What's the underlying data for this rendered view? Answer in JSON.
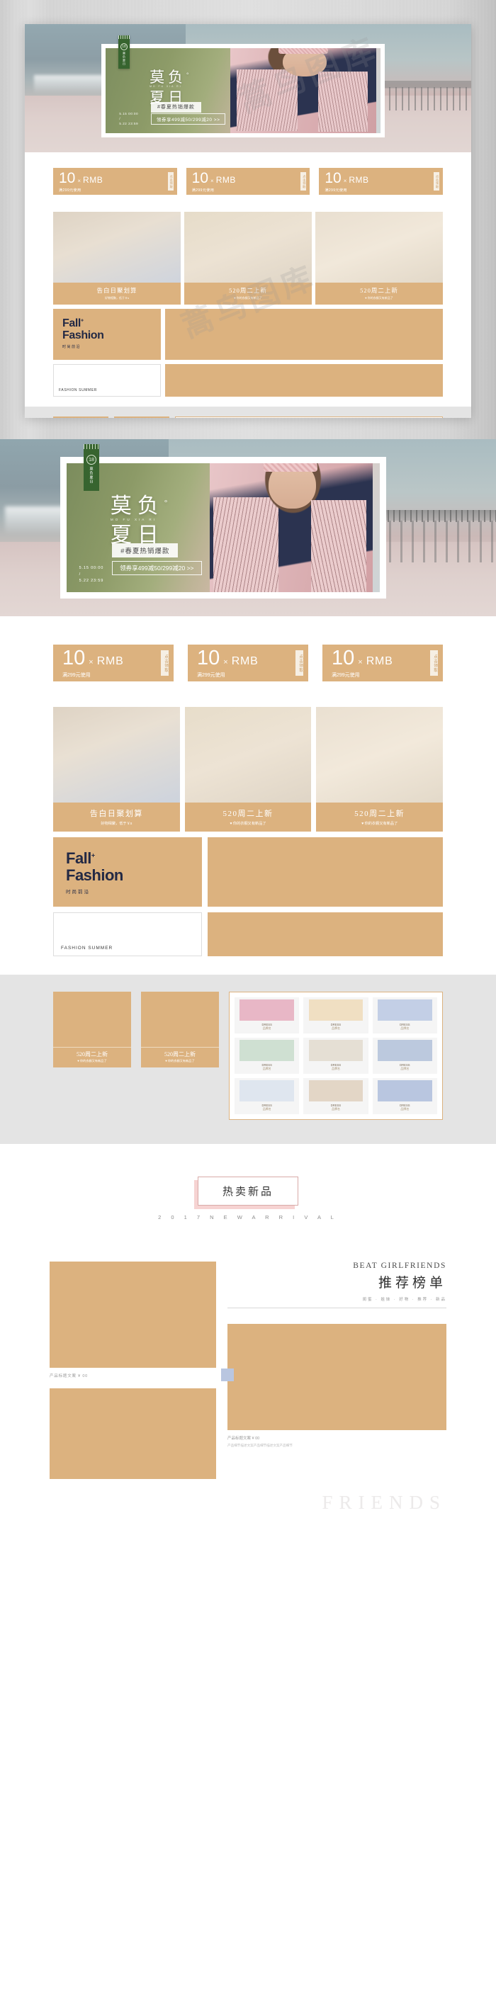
{
  "brand": {
    "tag_number": "18",
    "tag_vertical_text": "莫负夏日"
  },
  "hero": {
    "title_line1": "莫负",
    "degree": "°",
    "title_line2": "夏日",
    "sub_pinyin": "MO FU XIA RI",
    "hashtag": "#春夏热销爆款",
    "coupon_cta": "领券享499减50/299减20 >>",
    "date_start": "5.15  00:00",
    "date_sep": "/",
    "date_end": "5.22  23:59"
  },
  "coupons": [
    {
      "amount": "10",
      "times": "×",
      "currency": "RMB",
      "condition": "满299元使用",
      "action": "点击领取"
    },
    {
      "amount": "10",
      "times": "×",
      "currency": "RMB",
      "condition": "满299元使用",
      "action": "点击领取"
    },
    {
      "amount": "10",
      "times": "×",
      "currency": "RMB",
      "condition": "满299元使用",
      "action": "点击领取"
    }
  ],
  "products": [
    {
      "title": "告白日聚划算",
      "subtitle": "好物相聚，低于￥s"
    },
    {
      "title": "520周二上新",
      "subtitle": "♥ 你的衣橱又有新品了"
    },
    {
      "title": "520周二上新",
      "subtitle": "♥ 你的衣橱又有新品了"
    }
  ],
  "fall_block": {
    "line1": "Fall",
    "plus": "+",
    "line2": "Fashion",
    "cn": "时尚前沿"
  },
  "fashion_card": {
    "label": "FASHION SUMMER"
  },
  "grey_band": {
    "cells": [
      {
        "title": "520周二上新",
        "subtitle": "♥ 你的衣橱又有新品了"
      },
      {
        "title": "520周二上新",
        "subtitle": "♥ 你的衣橱又有新品了"
      }
    ],
    "minis": [
      {
        "name": "DRESS",
        "price": "品牌名",
        "color": "#e8b7c6"
      },
      {
        "name": "DRESS",
        "price": "品牌名",
        "color": "#f0dfc2"
      },
      {
        "name": "DRESS",
        "price": "品牌名",
        "color": "#c3cfe6"
      },
      {
        "name": "DRESS",
        "price": "品牌名",
        "color": "#cfe0d2"
      },
      {
        "name": "DRESS",
        "price": "品牌名",
        "color": "#e5dfd4"
      },
      {
        "name": "DRESS",
        "price": "品牌名",
        "color": "#bcc9de"
      },
      {
        "name": "DRESS",
        "price": "品牌名",
        "color": "#dfe6ef"
      },
      {
        "name": "DRESS",
        "price": "品牌名",
        "color": "#e3d6c6"
      },
      {
        "name": "DRESS",
        "price": "品牌名",
        "color": "#b9c6e0"
      }
    ]
  },
  "hot_section": {
    "badge": "热卖新品",
    "subtitle": "2 0 1 7  N E W  A R R I V A L"
  },
  "recommend": {
    "title_en": "BEAT GIRLFRIENDS",
    "title_cn": "推荐榜单",
    "meta": "闺蜜 · 姐妹 · 好物 · 推荐 · 新品",
    "left_label": "产品标题文案 ¥ 00",
    "right_label": "产品标题文案 ¥ 00",
    "right_desc": "产品细节描述文案产品细节描述文案产品细节",
    "footer_word": "FRIENDS"
  },
  "watermarks": [
    "蒿鸟图库",
    "蒿鸟图库"
  ],
  "colors": {
    "tan": "#dcb27f",
    "green_tag": "#37642f",
    "navy": "#232944",
    "pink_badge": "#f6d3d2",
    "grey_band": "#e4e4e4"
  }
}
